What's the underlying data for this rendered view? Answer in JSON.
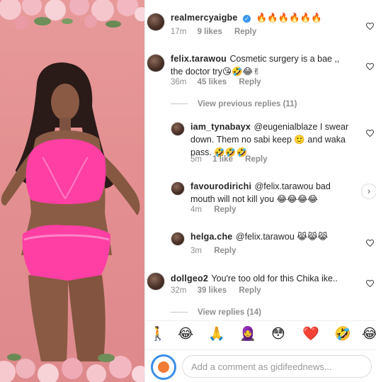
{
  "comments": [
    {
      "username": "realmercyaigbe",
      "verified": true,
      "text": "🔥🔥🔥🔥🔥🔥",
      "time": "17m",
      "likes": "9 likes",
      "reply": "Reply"
    },
    {
      "username": "felix.tarawou",
      "text": "Cosmetic surgery is a bae ,, the doctor try😘🤣😂✌",
      "time": "36m",
      "likes": "45 likes",
      "reply": "Reply",
      "view_replies": "View previous replies (11)",
      "replies": [
        {
          "username": "iam_tynabayx",
          "text": "@eugenialblaze I swear down. Them no sabi keep 🙂 and waka pass. 🤣🤣🤣",
          "time": "5m",
          "likes": "1 like",
          "reply": "Reply"
        },
        {
          "username": "favourodirichi",
          "text": "@felix.tarawou bad mouth will not kill you 😂😂😂😂",
          "time": "4m",
          "reply": "Reply"
        },
        {
          "username": "helga.che",
          "text": "@felix.tarawou 😹😹😹",
          "time": "3m",
          "reply": "Reply"
        }
      ]
    },
    {
      "username": "dollgeo2",
      "text": "You're too old for this Chika ike..",
      "time": "32m",
      "likes": "39 likes",
      "reply": "Reply",
      "view_replies": "View replies (14)"
    }
  ],
  "emoji_bar": [
    "🚶",
    "😂",
    "🙏",
    "🧕",
    "😳",
    "❤️",
    "🤣",
    "😂"
  ],
  "comment_box": {
    "placeholder": "Add a comment as gidifeednews..."
  },
  "colors": {
    "photo_bg": "#e48f91",
    "swimsuit": "#ff3fa4",
    "verified_badge": "#3897f0",
    "muted_text": "#8e8e8e"
  }
}
